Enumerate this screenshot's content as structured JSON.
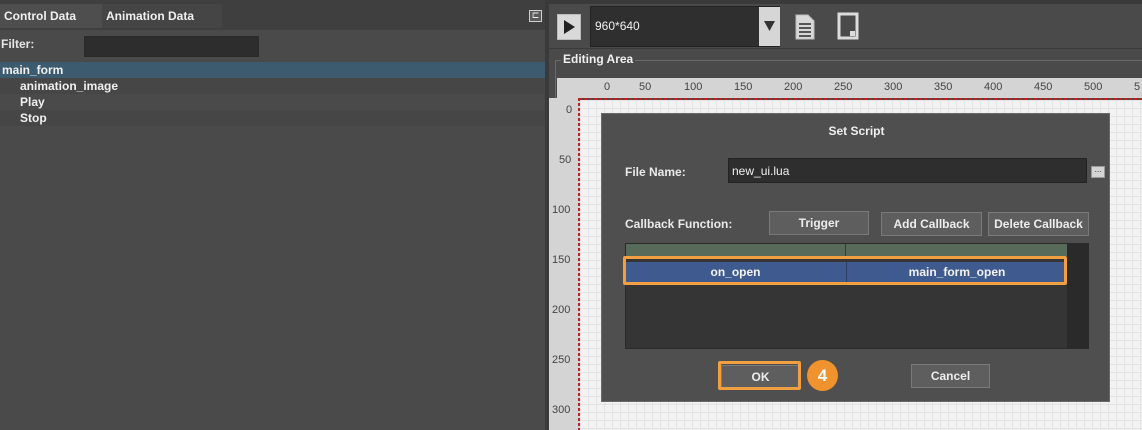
{
  "left_panel": {
    "tabs": [
      "Control Data",
      "Animation Data"
    ],
    "pin_icon": "pin-icon",
    "filter_label": "Filter:",
    "filter_value": "",
    "tree": {
      "root": "main_form",
      "children": [
        "animation_image",
        "Play",
        "Stop"
      ]
    }
  },
  "toolbar": {
    "play_icon": "play-icon",
    "resolution": "960*640",
    "dropdown_icon": "chevron-down-icon",
    "document_icon": "document-icon",
    "frame_icon": "frame-icon"
  },
  "editing_area": {
    "title": "Editing Area",
    "h_ruler": [
      "0",
      "50",
      "100",
      "150",
      "200",
      "250",
      "300",
      "350",
      "400",
      "450",
      "500",
      "5"
    ],
    "v_ruler": [
      "0",
      "50",
      "100",
      "150",
      "200",
      "250",
      "300"
    ]
  },
  "dialog": {
    "title": "Set Script",
    "file_name_label": "File Name:",
    "file_name_value": "new_ui.lua",
    "browse_label": "...",
    "callback_label": "Callback Function:",
    "trigger_button": "Trigger",
    "add_callback_button": "Add Callback",
    "delete_callback_button": "Delete Callback",
    "callbacks": [
      {
        "event": "on_open",
        "function": "main_form_open"
      }
    ],
    "ok_button": "OK",
    "cancel_button": "Cancel",
    "step_badge": "4"
  },
  "colors": {
    "highlight": "#f0a040",
    "selected_row": "#3f5a8e",
    "badge": "#f0922e"
  }
}
